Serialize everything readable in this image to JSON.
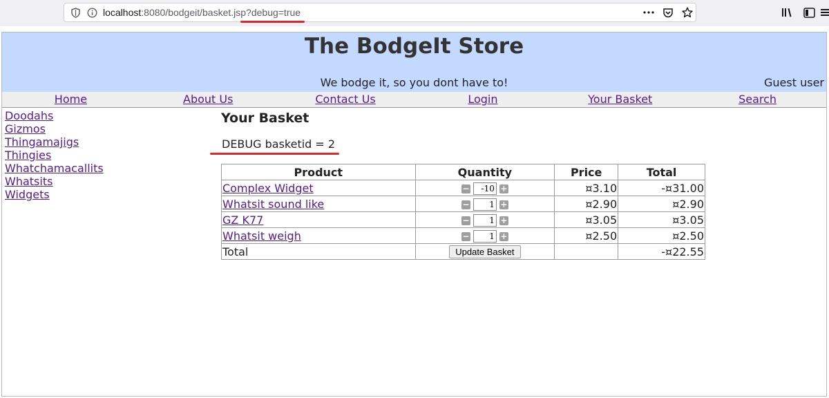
{
  "browser": {
    "url_host": "localhost",
    "url_rest": ":8080/bodgeit/basket.jsp?debug=true",
    "accent_red": "#e0252b"
  },
  "site": {
    "title": "The BodgeIt Store",
    "tagline": "We bodge it, so you dont have to!",
    "user_status": "Guest user",
    "header_color": "#c3d9ff"
  },
  "nav": [
    {
      "label": "Home"
    },
    {
      "label": "About Us"
    },
    {
      "label": "Contact Us"
    },
    {
      "label": "Login"
    },
    {
      "label": "Your Basket"
    },
    {
      "label": "Search"
    }
  ],
  "sidebar": [
    {
      "label": "Doodahs"
    },
    {
      "label": "Gizmos"
    },
    {
      "label": "Thingamajigs"
    },
    {
      "label": "Thingies"
    },
    {
      "label": "Whatchamacallits"
    },
    {
      "label": "Whatsits"
    },
    {
      "label": "Widgets"
    }
  ],
  "basket": {
    "title": "Your Basket",
    "debug_text": "DEBUG basketid = 2",
    "columns": [
      "Product",
      "Quantity",
      "Price",
      "Total"
    ],
    "rows": [
      {
        "product": "Complex Widget",
        "quantity": "-10",
        "price": "¤3.10",
        "total": "-¤31.00"
      },
      {
        "product": "Whatsit sound like",
        "quantity": "1",
        "price": "¤2.90",
        "total": "¤2.90"
      },
      {
        "product": "GZ K77",
        "quantity": "1",
        "price": "¤3.05",
        "total": "¤3.05"
      },
      {
        "product": "Whatsit weigh",
        "quantity": "1",
        "price": "¤2.50",
        "total": "¤2.50"
      }
    ],
    "total_label": "Total",
    "update_label": "Update Basket",
    "grand_total": "-¤22.55"
  }
}
